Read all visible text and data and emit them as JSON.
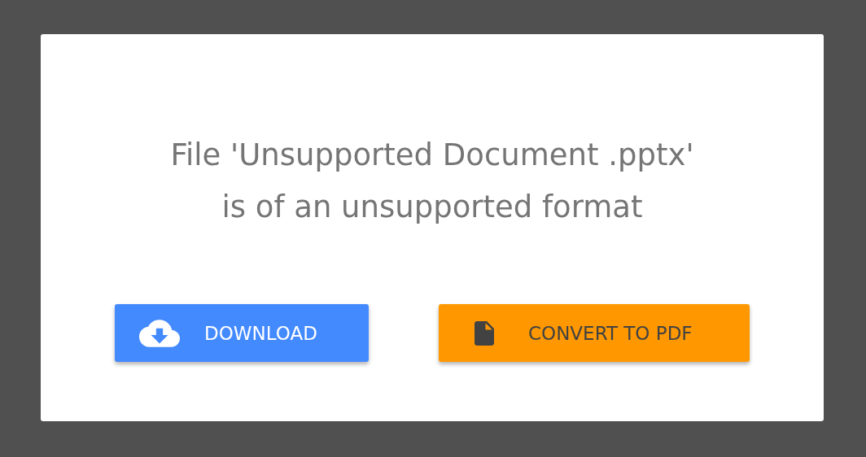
{
  "message": {
    "lines": [
      "File 'Unsupported Document .pptx'",
      "is of an unsupported format"
    ]
  },
  "buttons": [
    {
      "kind": "download",
      "label": "DOWNLOAD"
    },
    {
      "kind": "convert",
      "label": "CONVERT TO PDF"
    }
  ]
}
